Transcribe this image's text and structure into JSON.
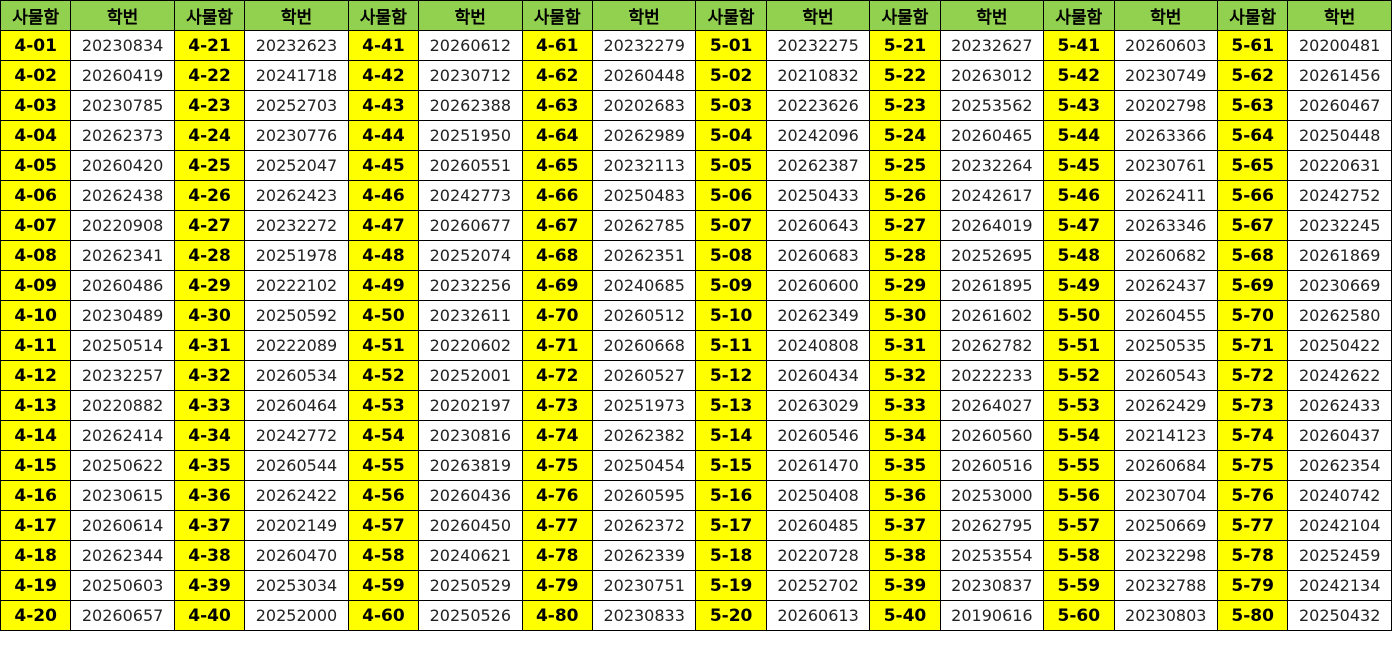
{
  "headers": [
    "사물함",
    "학번",
    "사물함",
    "학번",
    "사물함",
    "학번",
    "사물함",
    "학번",
    "사물함",
    "학번",
    "사물함",
    "학번",
    "사물함",
    "학번",
    "사물함",
    "학번"
  ],
  "rows": [
    [
      "4-01",
      "20230834",
      "4-21",
      "20232623",
      "4-41",
      "20260612",
      "4-61",
      "20232279",
      "5-01",
      "20232275",
      "5-21",
      "20232627",
      "5-41",
      "20260603",
      "5-61",
      "20200481"
    ],
    [
      "4-02",
      "20260419",
      "4-22",
      "20241718",
      "4-42",
      "20230712",
      "4-62",
      "20260448",
      "5-02",
      "20210832",
      "5-22",
      "20263012",
      "5-42",
      "20230749",
      "5-62",
      "20261456"
    ],
    [
      "4-03",
      "20230785",
      "4-23",
      "20252703",
      "4-43",
      "20262388",
      "4-63",
      "20202683",
      "5-03",
      "20223626",
      "5-23",
      "20253562",
      "5-43",
      "20202798",
      "5-63",
      "20260467"
    ],
    [
      "4-04",
      "20262373",
      "4-24",
      "20230776",
      "4-44",
      "20251950",
      "4-64",
      "20262989",
      "5-04",
      "20242096",
      "5-24",
      "20260465",
      "5-44",
      "20263366",
      "5-64",
      "20250448"
    ],
    [
      "4-05",
      "20260420",
      "4-25",
      "20252047",
      "4-45",
      "20260551",
      "4-65",
      "20232113",
      "5-05",
      "20262387",
      "5-25",
      "20232264",
      "5-45",
      "20230761",
      "5-65",
      "20220631"
    ],
    [
      "4-06",
      "20262438",
      "4-26",
      "20262423",
      "4-46",
      "20242773",
      "4-66",
      "20250483",
      "5-06",
      "20250433",
      "5-26",
      "20242617",
      "5-46",
      "20262411",
      "5-66",
      "20242752"
    ],
    [
      "4-07",
      "20220908",
      "4-27",
      "20232272",
      "4-47",
      "20260677",
      "4-67",
      "20262785",
      "5-07",
      "20260643",
      "5-27",
      "20264019",
      "5-47",
      "20263346",
      "5-67",
      "20232245"
    ],
    [
      "4-08",
      "20262341",
      "4-28",
      "20251978",
      "4-48",
      "20252074",
      "4-68",
      "20262351",
      "5-08",
      "20260683",
      "5-28",
      "20252695",
      "5-48",
      "20260682",
      "5-68",
      "20261869"
    ],
    [
      "4-09",
      "20260486",
      "4-29",
      "20222102",
      "4-49",
      "20232256",
      "4-69",
      "20240685",
      "5-09",
      "20260600",
      "5-29",
      "20261895",
      "5-49",
      "20262437",
      "5-69",
      "20230669"
    ],
    [
      "4-10",
      "20230489",
      "4-30",
      "20250592",
      "4-50",
      "20232611",
      "4-70",
      "20260512",
      "5-10",
      "20262349",
      "5-30",
      "20261602",
      "5-50",
      "20260455",
      "5-70",
      "20262580"
    ],
    [
      "4-11",
      "20250514",
      "4-31",
      "20222089",
      "4-51",
      "20220602",
      "4-71",
      "20260668",
      "5-11",
      "20240808",
      "5-31",
      "20262782",
      "5-51",
      "20250535",
      "5-71",
      "20250422"
    ],
    [
      "4-12",
      "20232257",
      "4-32",
      "20260534",
      "4-52",
      "20252001",
      "4-72",
      "20260527",
      "5-12",
      "20260434",
      "5-32",
      "20222233",
      "5-52",
      "20260543",
      "5-72",
      "20242622"
    ],
    [
      "4-13",
      "20220882",
      "4-33",
      "20260464",
      "4-53",
      "20202197",
      "4-73",
      "20251973",
      "5-13",
      "20263029",
      "5-33",
      "20264027",
      "5-53",
      "20262429",
      "5-73",
      "20262433"
    ],
    [
      "4-14",
      "20262414",
      "4-34",
      "20242772",
      "4-54",
      "20230816",
      "4-74",
      "20262382",
      "5-14",
      "20260546",
      "5-34",
      "20260560",
      "5-54",
      "20214123",
      "5-74",
      "20260437"
    ],
    [
      "4-15",
      "20250622",
      "4-35",
      "20260544",
      "4-55",
      "20263819",
      "4-75",
      "20250454",
      "5-15",
      "20261470",
      "5-35",
      "20260516",
      "5-55",
      "20260684",
      "5-75",
      "20262354"
    ],
    [
      "4-16",
      "20230615",
      "4-36",
      "20262422",
      "4-56",
      "20260436",
      "4-76",
      "20260595",
      "5-16",
      "20250408",
      "5-36",
      "20253000",
      "5-56",
      "20230704",
      "5-76",
      "20240742"
    ],
    [
      "4-17",
      "20260614",
      "4-37",
      "20202149",
      "4-57",
      "20260450",
      "4-77",
      "20262372",
      "5-17",
      "20260485",
      "5-37",
      "20262795",
      "5-57",
      "20250669",
      "5-77",
      "20242104"
    ],
    [
      "4-18",
      "20262344",
      "4-38",
      "20260470",
      "4-58",
      "20240621",
      "4-78",
      "20262339",
      "5-18",
      "20220728",
      "5-38",
      "20253554",
      "5-58",
      "20232298",
      "5-78",
      "20252459"
    ],
    [
      "4-19",
      "20250603",
      "4-39",
      "20253034",
      "4-59",
      "20250529",
      "4-79",
      "20230751",
      "5-19",
      "20252702",
      "5-39",
      "20230837",
      "5-59",
      "20232788",
      "5-79",
      "20242134"
    ],
    [
      "4-20",
      "20260657",
      "4-40",
      "20252000",
      "4-60",
      "20250526",
      "4-80",
      "20230833",
      "5-20",
      "20260613",
      "5-40",
      "20190616",
      "5-60",
      "20230803",
      "5-80",
      "20250432"
    ]
  ],
  "colors": {
    "header_bg": "#92d050",
    "locker_bg": "#ffff00",
    "id_bg": "#ffffff"
  }
}
